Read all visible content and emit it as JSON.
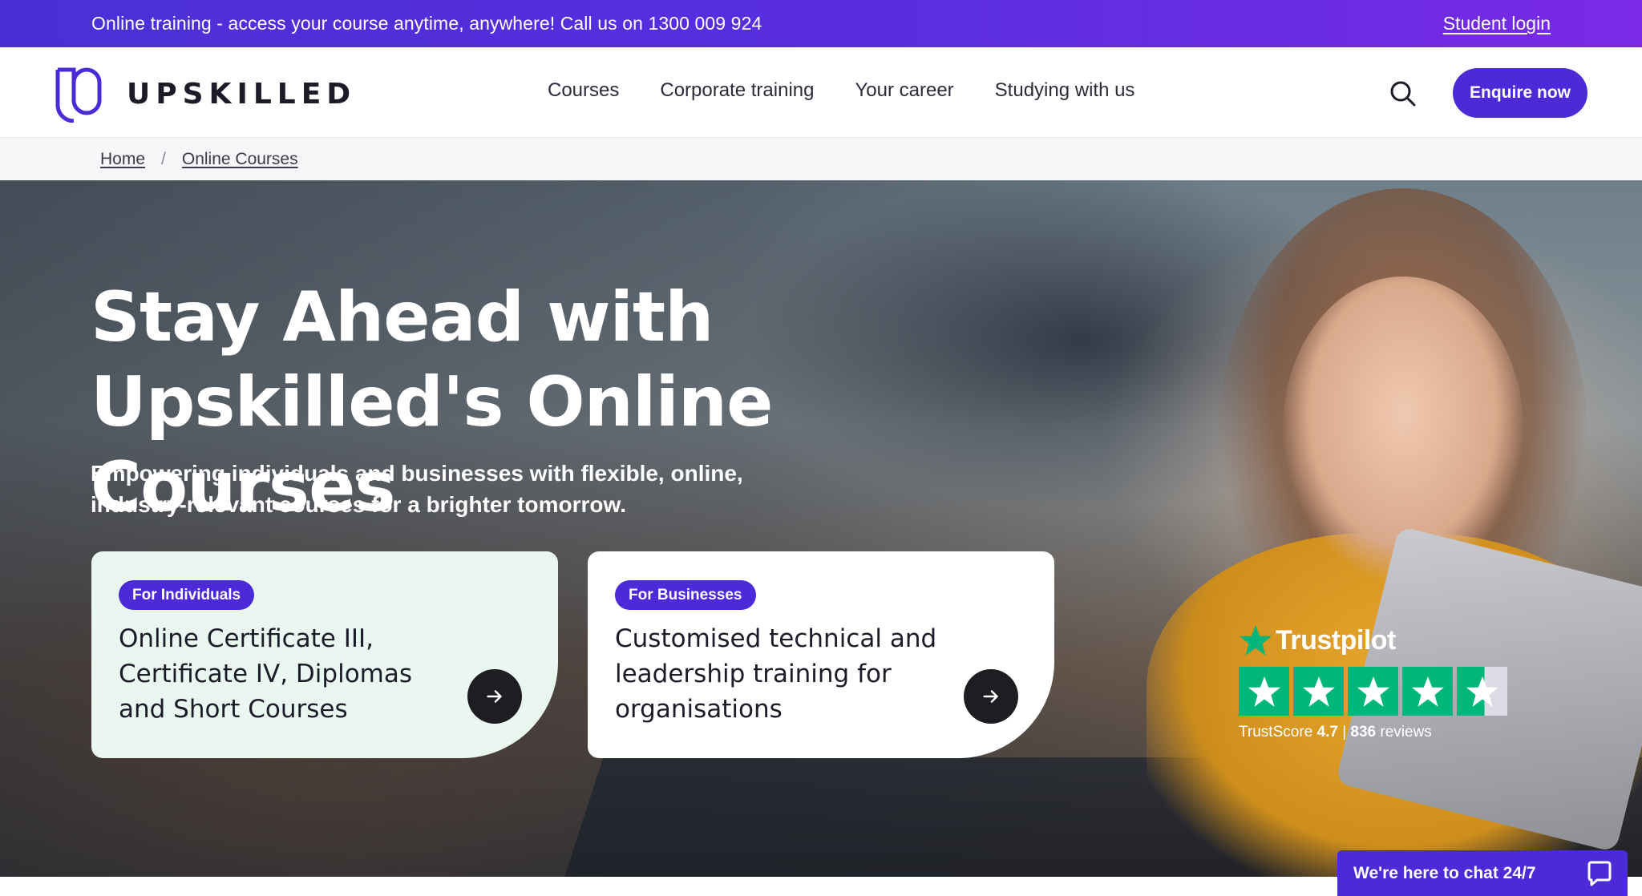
{
  "topbar": {
    "promo": "Online training - access your course anytime, anywhere! Call us on 1300 009 924",
    "login": "Student login"
  },
  "header": {
    "logo_text": "UPSKILLED",
    "nav": [
      "Courses",
      "Corporate training",
      "Your career",
      "Studying with us"
    ],
    "search_icon": "search-icon",
    "cta": "Enquire now"
  },
  "breadcrumb": {
    "items": [
      "Home",
      "Online Courses"
    ],
    "separator": "/"
  },
  "hero": {
    "title": "Stay Ahead with Upskilled's Online Courses",
    "subtitle": "Empowering individuals and businesses with flexible, online, industry-relevant courses for a brighter tomorrow.",
    "cards": [
      {
        "tag": "For Individuals",
        "text": "Online Certificate III, Certificate IV, Diplomas and Short Courses",
        "icon": "arrow-right-icon"
      },
      {
        "tag": "For Businesses",
        "text": "Customised technical and leadership training for organisations",
        "icon": "arrow-right-icon"
      }
    ]
  },
  "trustpilot": {
    "brand": "Trustpilot",
    "score_label": "TrustScore",
    "score": "4.7",
    "divider": "|",
    "reviews_count": "836",
    "reviews_label": "reviews",
    "stars": 4.7,
    "star_color": "#00b67a"
  },
  "chat": {
    "label": "We're here to chat 24/7",
    "icon": "chat-bubble-icon"
  },
  "colors": {
    "brand": "#4b2ad8",
    "card_individuals_bg": "#eaf7f1",
    "card_businesses_bg": "#ffffff"
  }
}
